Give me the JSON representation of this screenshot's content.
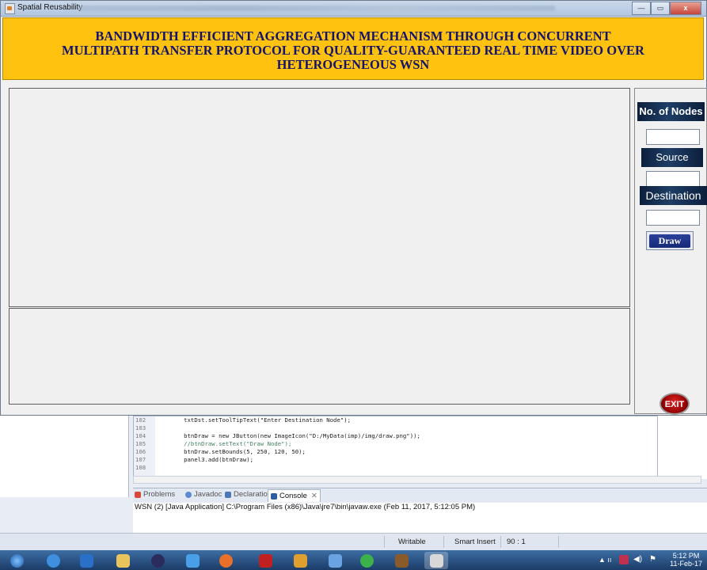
{
  "window": {
    "title": "Spatial Reusability",
    "controls": {
      "minimize": "—",
      "maximize": "▭",
      "close": "x"
    }
  },
  "banner": {
    "line1": "BANDWIDTH EFFICIENT AGGREGATION MECHANISM THROUGH CONCURRENT",
    "line2": "MULTIPATH TRANSFER PROTOCOL FOR QUALITY-GUARANTEED REAL TIME VIDEO OVER",
    "line3": "HETEROGENEOUS WSN"
  },
  "panel": {
    "nodes_label": "No. of Nodes",
    "source_label": "Source",
    "destination_label": "Destination",
    "nodes_value": "",
    "source_value": "",
    "destination_value": "",
    "draw_label": "Draw",
    "exit_label": "EXIT"
  },
  "editor": {
    "lines": [
      {
        "no": "102",
        "code": "        txtDst.setToolTipText(\"Enter Destination Node\");"
      },
      {
        "no": "103",
        "code": ""
      },
      {
        "no": "104",
        "code": "        btnDraw = new JButton(new ImageIcon(\"D:/MyData(imp)/img/draw.png\"));"
      },
      {
        "no": "105",
        "code": "        //btnDraw.setText(\"Draw Node\");"
      },
      {
        "no": "106",
        "code": "        btnDraw.setBounds(5, 250, 120, 50);"
      },
      {
        "no": "107",
        "code": "        panel3.add(btnDraw);"
      },
      {
        "no": "108",
        "code": ""
      }
    ]
  },
  "views": {
    "tabs": [
      "Problems",
      "Javadoc",
      "Declaration",
      "Console"
    ],
    "console_header": "WSN (2) [Java Application] C:\\Program Files (x86)\\Java\\jre7\\bin\\javaw.exe (Feb 11, 2017, 5:12:05 PM)"
  },
  "statusbar": {
    "writable": "Writable",
    "insert_mode": "Smart Insert",
    "position": "90 : 1"
  },
  "taskbar": {
    "time": "5:12 PM",
    "date": "11-Feb-17"
  },
  "colors": {
    "banner_bg": "#ffc20e",
    "banner_text": "#14146b",
    "label_navy": "#0c1f3c",
    "draw_button": "#1f3590",
    "exit_red": "#c81414"
  }
}
